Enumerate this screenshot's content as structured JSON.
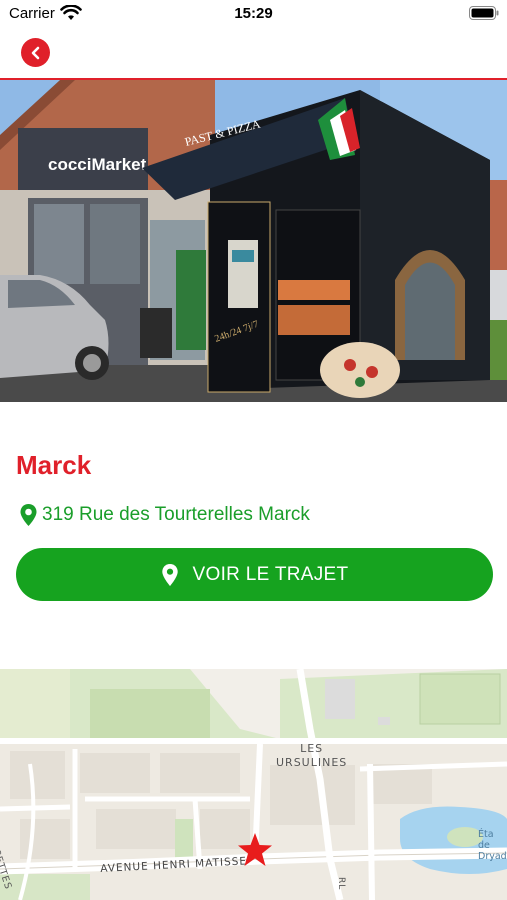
{
  "status_bar": {
    "carrier": "Carrier",
    "time": "15:29"
  },
  "nav": {
    "back_icon": "chevron-left-icon",
    "accent_color": "#e0202a"
  },
  "hero": {
    "image_alt": "pizza vending kiosk",
    "sign_text": "PAST & PIZZA",
    "store_sign": "cocciMarket",
    "hours_text": "24h/24 7j/7"
  },
  "place": {
    "title": "Marck",
    "address": "319 Rue des Tourterelles Marck",
    "address_icon": "map-pin-icon",
    "route_button_label": "VOIR LE TRAJET",
    "route_button_icon": "map-pin-icon",
    "title_color": "#e0202a",
    "button_color": "#16a31f"
  },
  "map": {
    "labels": {
      "ursulines": "LES\nURSULINES",
      "matisse": "AVENUE HENRI MATISSE",
      "avocettes": "ES AVOCETTES",
      "etang": "Éta\nde\nDryad",
      "r": "RL"
    },
    "marker_icon": "star-icon",
    "marker_color": "#e81c1c"
  }
}
